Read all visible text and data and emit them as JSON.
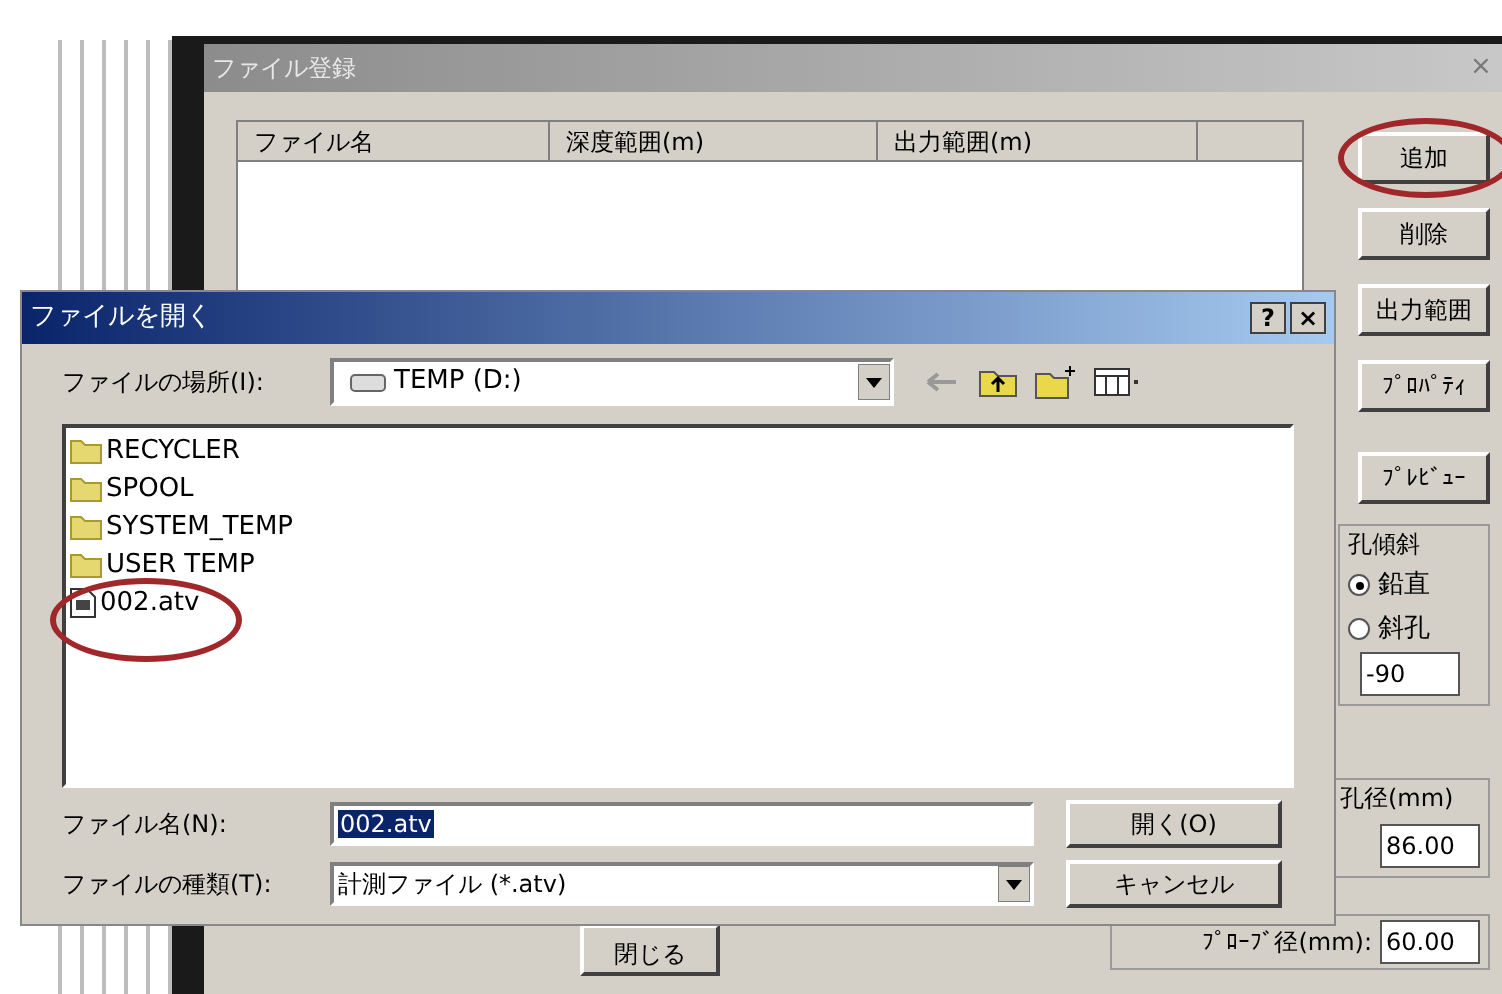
{
  "back_window": {
    "title": "ファイル登録",
    "close": "×",
    "columns": [
      "ファイル名",
      "深度範囲(m)",
      "出力範囲(m)"
    ],
    "buttons": [
      {
        "label": "追加",
        "circled": true
      },
      {
        "label": "削除",
        "circled": false
      },
      {
        "label": "出力範囲",
        "circled": false
      },
      {
        "label": "ﾌﾟﾛﾊﾟﾃｨ",
        "circled": false
      },
      {
        "label": "ﾌﾟﾚﾋﾞｭｰ",
        "circled": false
      }
    ],
    "inclination": {
      "title": "孔傾斜",
      "options": [
        {
          "label": "鉛直",
          "selected": true
        },
        {
          "label": "斜孔",
          "selected": false
        }
      ],
      "value": "-90"
    },
    "hole_diameter": {
      "label": "孔径(mm)",
      "value": "86.00"
    },
    "probe_diameter": {
      "label": "ﾌﾟﾛｰﾌﾞ径(mm):",
      "value": "60.00"
    },
    "close_button": "閉じる"
  },
  "dialog": {
    "title": "ファイルを開く",
    "help": "?",
    "close": "×",
    "look_in_label": "ファイルの場所(I):",
    "look_in": "TEMP (D:)",
    "items": [
      {
        "kind": "folder",
        "name": "RECYCLER",
        "circled": false
      },
      {
        "kind": "folder",
        "name": "SPOOL",
        "circled": false
      },
      {
        "kind": "folder",
        "name": "SYSTEM_TEMP",
        "circled": false
      },
      {
        "kind": "folder",
        "name": "USER TEMP",
        "circled": false
      },
      {
        "kind": "file",
        "name": "002.atv",
        "circled": true
      }
    ],
    "filename_label": "ファイル名(N):",
    "filename": "002.atv",
    "filetype_label": "ファイルの種類(T):",
    "filetype": "計測ファイル (*.atv)",
    "open_button": "開く(O)",
    "cancel_button": "キャンセル"
  }
}
